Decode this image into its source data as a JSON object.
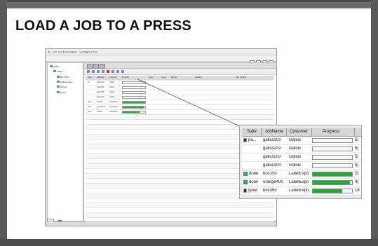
{
  "slide": {
    "title": "LOAD A JOB TO A PRESS"
  },
  "app": {
    "menu_items": [
      "file",
      "edit",
      "view",
      "bookmarks",
      "tools",
      "members",
      "actions",
      "help"
    ],
    "tree_items": [
      "Gallus",
      "Gallus",
      "ECS 340",
      "Gallus/Indigo",
      "Offsets",
      "Press"
    ],
    "small_table": {
      "columns": [
        "State",
        "JobName",
        "Customer",
        "Progress",
        "Count",
        "Target",
        "Printed",
        "Deadline",
        "Date Created"
      ],
      "rows": [
        {
          "state": "pa",
          "job": "gallus100",
          "customer": "Gallus",
          "progress": 0.0
        },
        {
          "state": "",
          "job": "gallus200",
          "customer": "Gallus",
          "progress": 0.0
        },
        {
          "state": "",
          "job": "gallus250",
          "customer": "Gallus",
          "progress": 0.0
        },
        {
          "state": "",
          "job": "gallus300",
          "customer": "Gallus",
          "progress": 0.0
        },
        {
          "state": "done",
          "job": "box250",
          "customer": "LabelExpo",
          "progress": 1.0
        },
        {
          "state": "done",
          "job": "orange400",
          "customer": "LabelExpo",
          "progress": 0.95
        },
        {
          "state": "good",
          "job": "box350",
          "customer": "LabelExpo",
          "progress": 0.75
        }
      ]
    }
  },
  "callout": {
    "columns": [
      "State",
      "JobName",
      "Customer",
      "Progress"
    ],
    "rows": [
      {
        "state": "pa...",
        "state_icon": "job-icon",
        "job": "gallus100",
        "customer": "Gallus",
        "progress": 0.0,
        "extra": "5("
      },
      {
        "state": "",
        "state_icon": "",
        "job": "gallus200",
        "customer": "Gallus",
        "progress": 0.0,
        "extra": "5("
      },
      {
        "state": "",
        "state_icon": "",
        "job": "gallus250",
        "customer": "Gallus",
        "progress": 0.0,
        "extra": "5("
      },
      {
        "state": "",
        "state_icon": "",
        "job": "gallus300",
        "customer": "Gallus",
        "progress": 0.0,
        "extra": "5("
      },
      {
        "state": "done",
        "state_icon": "check-icon",
        "job": "box250",
        "customer": "LabelExpo",
        "progress": 1.0,
        "extra": "2("
      },
      {
        "state": "done",
        "state_icon": "check-icon",
        "job": "orange400",
        "customer": "LabelExpo",
        "progress": 0.95,
        "extra": "4("
      },
      {
        "state": "good",
        "state_icon": "job-icon",
        "job": "box350",
        "customer": "LabelExpo",
        "progress": 0.75,
        "extra": "18"
      }
    ]
  },
  "colors": {
    "progress_fill": "#2fa23d",
    "frame": "#4d4d4d"
  }
}
